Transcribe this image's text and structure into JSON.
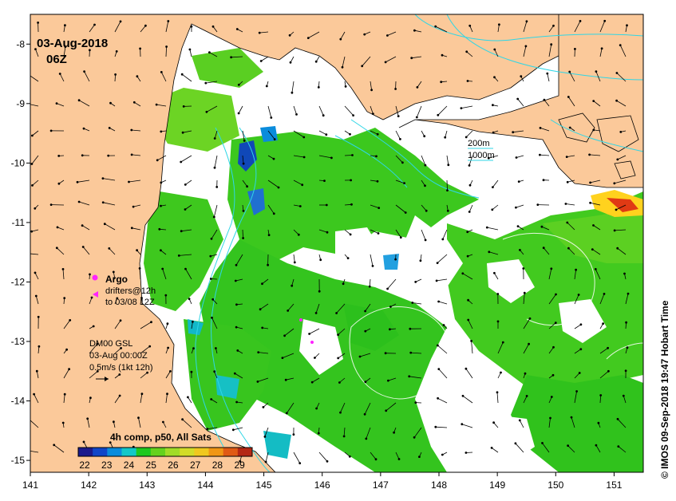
{
  "header": {
    "date": "03-Aug-2018",
    "time": "06Z"
  },
  "credit": "© IMOS 09-Sep-2018 19:47 Hobart Time",
  "depth_legend": {
    "shallow": "200m",
    "deep": "1000m"
  },
  "argo": {
    "title": "Argo",
    "line1": "drifters@12h",
    "line2": "to 03/08 12Z"
  },
  "current_legend": {
    "title": "DM00 GSL",
    "date": "03-Aug 00:00Z",
    "scale": "0.5m/s (1kt 12h)"
  },
  "colorbar": {
    "title": "4h comp, p50, All Sats",
    "labels": [
      "22",
      "23",
      "24",
      "25",
      "26",
      "27",
      "28",
      "29"
    ],
    "colors": [
      "#1a1a8c",
      "#1046c8",
      "#0a8cdc",
      "#12c8c8",
      "#1ec81e",
      "#64d21e",
      "#a0dc28",
      "#d2dc28",
      "#f0c81e",
      "#f09614",
      "#e05a14",
      "#b42814"
    ]
  },
  "chart_data": {
    "type": "heatmap",
    "title": "03-Aug-2018 06Z",
    "xlabel": "",
    "ylabel": "",
    "xlim": [
      141,
      151.5
    ],
    "ylim": [
      -15.2,
      -7.5
    ],
    "x_ticks": [
      "141",
      "142",
      "143",
      "144",
      "145",
      "146",
      "147",
      "148",
      "149",
      "150",
      "151"
    ],
    "y_ticks": [
      "-8",
      "-9",
      "-10",
      "-11",
      "-12",
      "-13",
      "-14",
      "-15"
    ],
    "value_range": [
      22,
      29.5
    ],
    "colors": {
      "land": "#fbc99a",
      "cloud": "#ffffff",
      "isobath": "#2fd6e6"
    }
  }
}
